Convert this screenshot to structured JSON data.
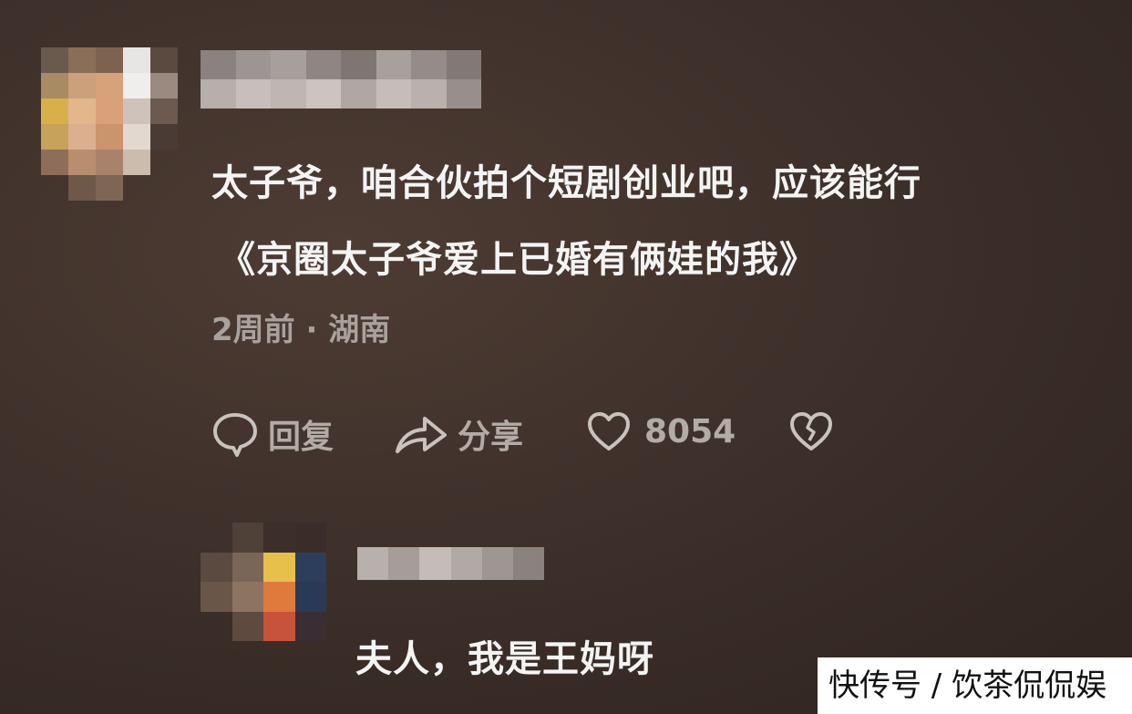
{
  "comment1": {
    "line1": "太子爷，咱合伙拍个短剧创业吧，应该能行",
    "line2": "《京圈太子爷爱上已婚有俩娃的我》",
    "meta": "2周前 · 湖南",
    "actions": {
      "reply_label": "回复",
      "share_label": "分享",
      "like_count": "8054"
    }
  },
  "comment2": {
    "text": "夫人，我是王妈呀"
  },
  "watermark": "快传号 / 饮茶侃侃娱",
  "colors": {
    "background": "#3e302a",
    "text": "#f4f4f4",
    "meta": "#a9a19c",
    "watermark_bg": "#ffffff"
  },
  "icons": [
    "comment-bubble-icon",
    "share-arrow-icon",
    "heart-icon",
    "broken-heart-icon"
  ]
}
